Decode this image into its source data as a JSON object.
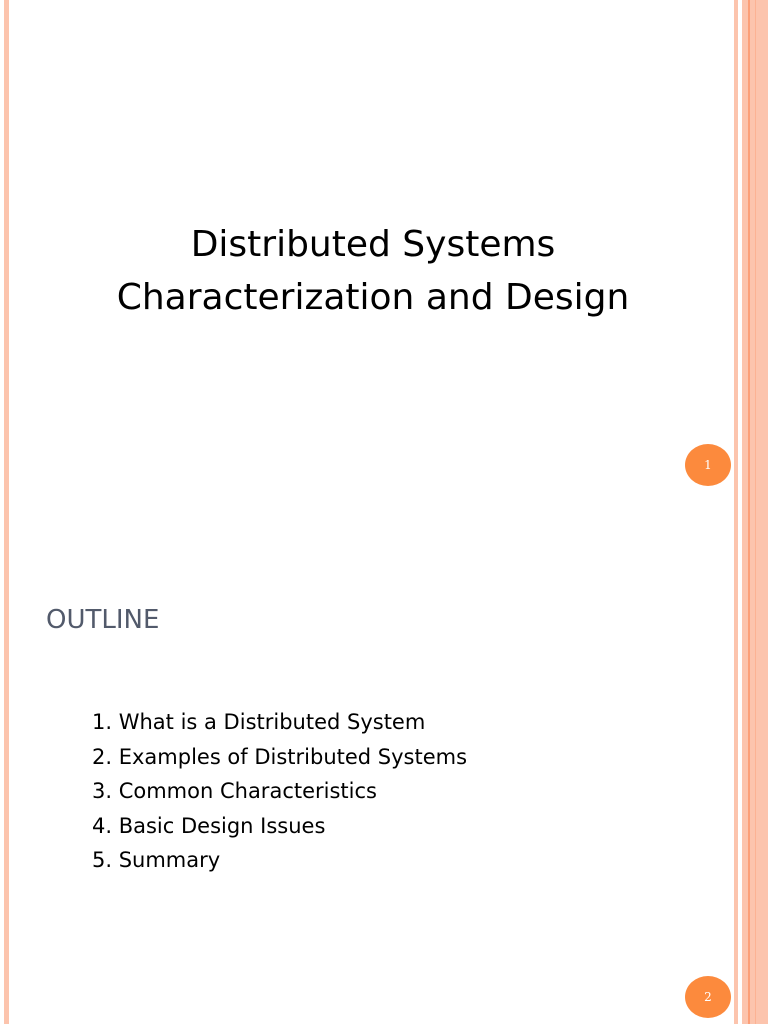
{
  "slide1": {
    "title_line1": "Distributed Systems",
    "title_line2": "Characterization and Design",
    "page_number": "1"
  },
  "slide2": {
    "heading": "OUTLINE",
    "items": [
      "1. What is a Distributed System",
      "2. Examples of Distributed Systems",
      "3. Common Characteristics",
      "4. Basic Design Issues",
      "5. Summary"
    ],
    "page_number": "2"
  },
  "colors": {
    "accent": "#fc8a3d",
    "border": "#fcc4ad"
  }
}
